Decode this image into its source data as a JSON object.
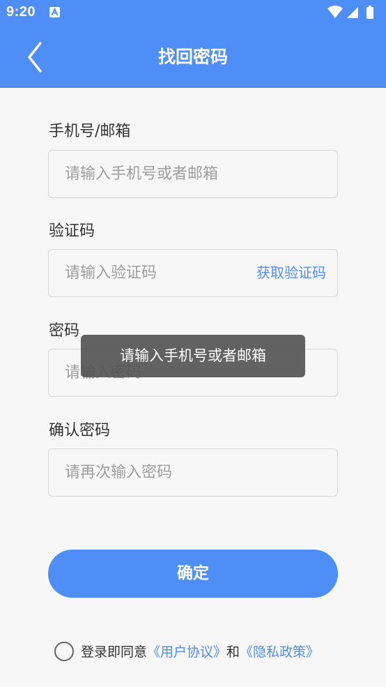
{
  "status": {
    "time": "9:20"
  },
  "header": {
    "title": "找回密码"
  },
  "form": {
    "account": {
      "label": "手机号/邮箱",
      "placeholder": "请输入手机号或者邮箱",
      "value": ""
    },
    "code": {
      "label": "验证码",
      "placeholder": "请输入验证码",
      "value": "",
      "button": "获取验证码"
    },
    "password": {
      "label": "密码",
      "placeholder": "请输入密码",
      "value": ""
    },
    "confirm": {
      "label": "确认密码",
      "placeholder": "请再次输入密码",
      "value": ""
    }
  },
  "toast": {
    "message": "请输入手机号或者邮箱"
  },
  "submit": {
    "label": "确定"
  },
  "agreement": {
    "prefix": "登录即同意",
    "terms": "《用户协议》",
    "and": "和",
    "privacy": "《隐私政策》",
    "checked": false
  },
  "colors": {
    "accent": "#4f8ef7",
    "background": "#f7f7f7",
    "toast": "#555555"
  },
  "icons": [
    "back-arrow-icon",
    "wifi-icon",
    "signal-icon",
    "battery-icon",
    "notification-a-icon"
  ]
}
